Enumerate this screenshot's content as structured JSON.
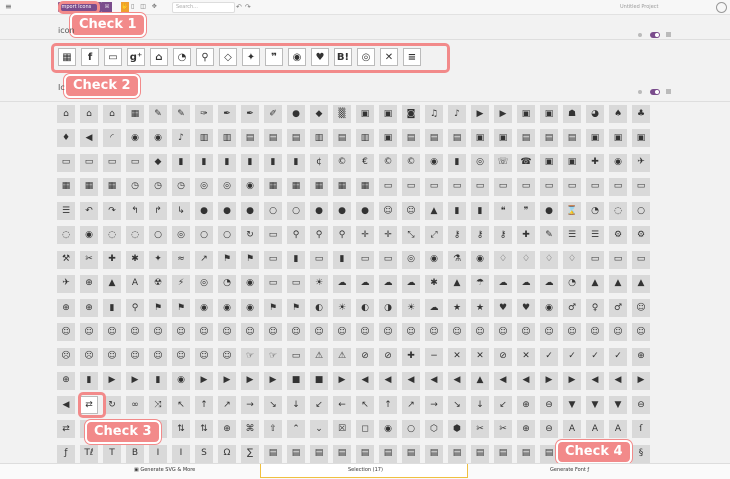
{
  "topbar": {
    "menu_icon": "≡",
    "import_label": "Import Icons",
    "library_label": "ℍ",
    "search_placeholder": "Search...",
    "project_name": "Untitled Project"
  },
  "callouts": [
    "Check 1",
    "Check 2",
    "Check 3",
    "Check 4"
  ],
  "sets": {
    "first_title": "icon",
    "second_title": "Ic"
  },
  "selected_icons": [
    {
      "name": "calendar-icon",
      "glyph": "▦"
    },
    {
      "name": "facebook-icon",
      "glyph": "f"
    },
    {
      "name": "folder-icon",
      "glyph": "▭"
    },
    {
      "name": "google-plus-icon",
      "glyph": "g⁺"
    },
    {
      "name": "home-icon",
      "glyph": "⌂"
    },
    {
      "name": "rss-icon",
      "glyph": "◔"
    },
    {
      "name": "search-icon",
      "glyph": "⚲"
    },
    {
      "name": "tag-icon",
      "glyph": "◇"
    },
    {
      "name": "twitter-icon",
      "glyph": "✦"
    },
    {
      "name": "quote-icon",
      "glyph": "❞"
    },
    {
      "name": "line-icon",
      "glyph": "◉"
    },
    {
      "name": "pocket-icon",
      "glyph": "♥"
    },
    {
      "name": "hatena-bookmark-icon",
      "glyph": "B!"
    },
    {
      "name": "instagram-icon",
      "glyph": "◎"
    },
    {
      "name": "close-icon",
      "glyph": "✕"
    },
    {
      "name": "menu-icon",
      "glyph": "≡"
    }
  ],
  "grid_glyphs": [
    "⌂",
    "⌂",
    "⌂",
    "▦",
    "✎",
    "✎",
    "✑",
    "✒",
    "✒",
    "✐",
    "●",
    "◆",
    "▒",
    "▣",
    "▣",
    "◙",
    "♫",
    "♪",
    "▶",
    "▶",
    "▣",
    "▣",
    "☗",
    "◕",
    "♠",
    "♣",
    "♦",
    "◀",
    "◜",
    "◉",
    "◉",
    "♪",
    "▥",
    "▥",
    "▤",
    "▤",
    "▤",
    "▥",
    "▤",
    "▥",
    "▣",
    "▤",
    "▤",
    "▤",
    "▣",
    "▣",
    "▤",
    "▤",
    "▤",
    "▣",
    "▣",
    "▣",
    "▭",
    "▭",
    "▭",
    "▭",
    "◆",
    "▮",
    "▮",
    "▮",
    "▮",
    "▮",
    "▮",
    "¢",
    "©",
    "€",
    "©",
    "©",
    "◉",
    "▮",
    "◎",
    "☏",
    "☎",
    "▣",
    "▣",
    "✚",
    "◉",
    "✈",
    "▦",
    "▦",
    "▦",
    "◷",
    "◷",
    "◷",
    "◎",
    "◎",
    "◉",
    "▦",
    "▦",
    "▦",
    "▦",
    "▦",
    "▭",
    "▭",
    "▭",
    "▭",
    "▭",
    "▭",
    "▭",
    "▭",
    "▭",
    "▭",
    "▭",
    "▭",
    "☰",
    "↶",
    "↷",
    "↰",
    "↱",
    "↳",
    "●",
    "●",
    "●",
    "○",
    "○",
    "●",
    "●",
    "●",
    "☺",
    "☺",
    "▲",
    "▮",
    "▮",
    "❝",
    "❞",
    "●",
    "⌛",
    "◔",
    "◌",
    "○",
    "◌",
    "◉",
    "◌",
    "◌",
    "○",
    "◎",
    "○",
    "○",
    "↻",
    "▭",
    "⚲",
    "⚲",
    "⚲",
    "✛",
    "✛",
    "⤡",
    "⤢",
    "⚷",
    "⚷",
    "⚷",
    "✚",
    "✎",
    "☰",
    "☰",
    "⚙",
    "⚙",
    "⚒",
    "✂",
    "✚",
    "✱",
    "✦",
    "≈",
    "↗",
    "⚑",
    "⚑",
    "▭",
    "▮",
    "▭",
    "▮",
    "▭",
    "▭",
    "◎",
    "◉",
    "⚗",
    "◉",
    "♢",
    "♢",
    "♢",
    "♢",
    "▭",
    "▭",
    "▭",
    "✈",
    "⊕",
    "▲",
    "A",
    "☢",
    "⚡",
    "◎",
    "◔",
    "◉",
    "▭",
    "▭",
    "☀",
    "☁",
    "☁",
    "☁",
    "☁",
    "✱",
    "▲",
    "☂",
    "☁",
    "☁",
    "☁",
    "◔",
    "▲",
    "▲",
    "▲",
    "⊕",
    "⊕",
    "▮",
    "⚲",
    "⚑",
    "⚑",
    "◉",
    "◉",
    "◉",
    "⚑",
    "⚑",
    "◐",
    "☀",
    "◐",
    "◑",
    "☀",
    "☁",
    "★",
    "★",
    "♥",
    "♥",
    "◉",
    "♂",
    "♀",
    "♂",
    "☺",
    "☺",
    "☺",
    "☺",
    "☺",
    "☺",
    "☺",
    "☺",
    "☺",
    "☺",
    "☺",
    "☺",
    "☺",
    "☺",
    "☺",
    "☺",
    "☺",
    "☺",
    "☺",
    "☺",
    "☺",
    "☺",
    "☺",
    "☺",
    "☺",
    "☺",
    "☺",
    "☹",
    "☹",
    "☺",
    "☺",
    "☺",
    "☺",
    "☺",
    "☺",
    "☞",
    "☞",
    "▭",
    "⚠",
    "⚠",
    "⊘",
    "⊘",
    "✚",
    "−",
    "✕",
    "✕",
    "⊘",
    "✕",
    "✓",
    "✓",
    "✓",
    "✓",
    "⊕",
    "⊕",
    "▮",
    "▶",
    "▶",
    "▮",
    "◉",
    "▶",
    "▶",
    "▶",
    "▶",
    "■",
    "■",
    "▶",
    "◀",
    "◀",
    "◀",
    "◀",
    "◀",
    "▲",
    "◀",
    "◀",
    "▶",
    "▶",
    "◀",
    "◀",
    "▶",
    "◀",
    "⇄",
    "↻",
    "∞",
    "⤨",
    "↖",
    "↑",
    "↗",
    "→",
    "↘",
    "↓",
    "↙",
    "←",
    "↖",
    "↑",
    "↗",
    "→",
    "↘",
    "↓",
    "↙",
    "⊕",
    "⊖",
    "▼",
    "▼",
    "▼",
    "⊖",
    "⇄",
    "⊟",
    "⇅",
    "⇅",
    "⇅",
    "⇅",
    "⇅",
    "⊕",
    "⌘",
    "⇧",
    "⌃",
    "⌄",
    "☒",
    "◻",
    "◉",
    "○",
    "⬡",
    "⬢",
    "✂",
    "✂",
    "⊕",
    "⊖",
    "A",
    "A",
    "A",
    "ſ",
    "ƒ",
    "Tℓ",
    "T",
    "B",
    "I",
    "I",
    "S",
    "Ω",
    "∑",
    "▤",
    "▤",
    "▤",
    "▤",
    "▤",
    "▤",
    "▤",
    "▤",
    "▤",
    "▤",
    "▤",
    "▤",
    "▤",
    "▤",
    "▤",
    "▤",
    "§"
  ],
  "bottombar": {
    "generate_svg": "Generate SVG & More",
    "selection": "Selection (17)",
    "generate_font": "Generate Font"
  }
}
